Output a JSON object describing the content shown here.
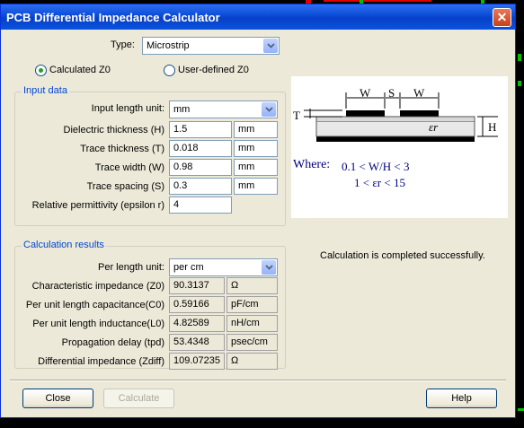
{
  "window": {
    "title": "PCB Differential Impedance Calculator"
  },
  "type": {
    "label": "Type:",
    "value": "Microstrip"
  },
  "mode": {
    "calculated": "Calculated Z0",
    "user_defined": "User-defined Z0"
  },
  "input": {
    "title": "Input data",
    "length_unit_label": "Input length unit:",
    "length_unit_value": "mm",
    "fields": [
      {
        "label": "Dielectric thickness (H)",
        "value": "1.5",
        "unit": "mm"
      },
      {
        "label": "Trace thickness (T)",
        "value": "0.018",
        "unit": "mm"
      },
      {
        "label": "Trace width (W)",
        "value": "0.98",
        "unit": "mm"
      },
      {
        "label": "Trace spacing (S)",
        "value": "0.3",
        "unit": "mm"
      },
      {
        "label": "Relative permittivity (epsilon r)",
        "value": "4"
      }
    ]
  },
  "results": {
    "title": "Calculation results",
    "per_length_label": "Per length unit:",
    "per_length_value": "per cm",
    "rows": [
      {
        "label": "Characteristic impedance (Z0)",
        "value": "90.3137",
        "unit": "Ω"
      },
      {
        "label": "Per unit length capacitance(C0)",
        "value": "0.59166",
        "unit": "pF/cm"
      },
      {
        "label": "Per unit length inductance(L0)",
        "value": "4.82589",
        "unit": "nH/cm"
      },
      {
        "label": "Propagation delay (tpd)",
        "value": "53.4348",
        "unit": "psec/cm"
      },
      {
        "label": "Differential impedance (Zdiff)",
        "value": "109.07235",
        "unit": "Ω"
      }
    ]
  },
  "status": "Calculation is completed successfully.",
  "diagram": {
    "w1": "W",
    "s": "S",
    "w2": "W",
    "t": "T",
    "h": "H",
    "er": "εr",
    "where": "Where:",
    "cond1": "0.1 <  W/H  < 3",
    "cond2": "1 <   εr   < 15"
  },
  "buttons": {
    "close": "Close",
    "calculate": "Calculate",
    "help": "Help"
  },
  "colors": {
    "title_bar": "#0a4bd6",
    "group_title": "#0046d5",
    "background": "#000000"
  }
}
